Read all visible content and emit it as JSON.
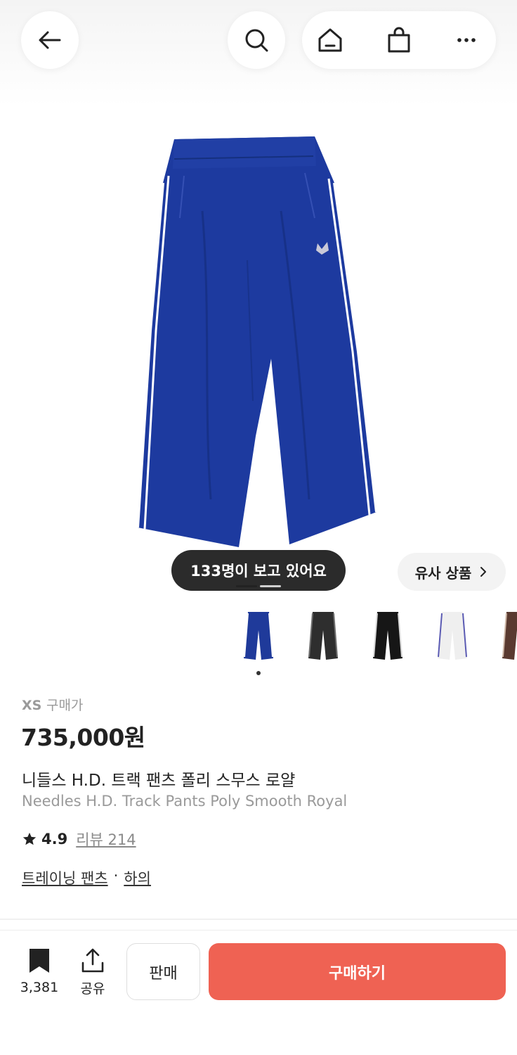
{
  "header": {
    "back_icon": "arrow-left-icon",
    "search_icon": "search-icon",
    "home_icon": "home-icon",
    "shopping_bag_icon": "shopping-bag-icon",
    "more_icon": "more-horizontal-icon"
  },
  "product": {
    "viewers_text": "133명이 보고 있어요",
    "similar_button_label": "유사 상품",
    "thumbnails": [
      {
        "color": "#1f3a9a",
        "stripe": "#ffffff"
      },
      {
        "color": "#2e2e2e",
        "stripe": "#6f6f6f"
      },
      {
        "color": "#161616",
        "stripe": "#d9d9d9"
      },
      {
        "color": "#efefef",
        "stripe": "#5b5bb3"
      },
      {
        "color": "#5a3a30",
        "stripe": "#cdb6a6"
      }
    ],
    "size_label": "XS",
    "size_label_suffix": "구매가",
    "price": "735,000원",
    "name_ko": "니들스 H.D. 트랙 팬츠 폴리 스무스 로얄",
    "name_en": "Needles H.D. Track Pants Poly Smooth Royal",
    "rating": "4.9",
    "review_link": "리뷰 214",
    "category": "트레이닝 팬츠",
    "category_separator": "·",
    "subcategory": "하의"
  },
  "bottom_bar": {
    "bookmark_count": "3,381",
    "share_label": "공유",
    "sell_label": "판매",
    "buy_label": "구매하기"
  },
  "colors": {
    "accent": "#ef6253",
    "pants_main": "#1d3a9f",
    "pants_stripe": "#ffffff"
  }
}
